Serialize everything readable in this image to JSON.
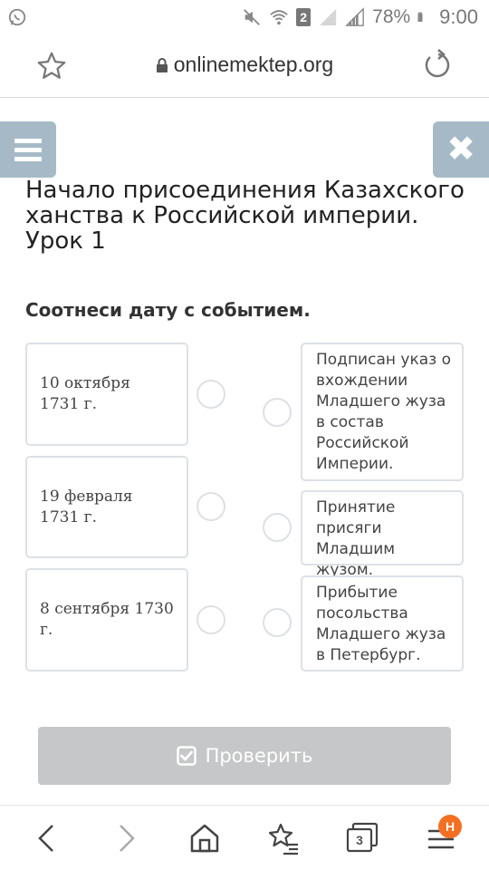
{
  "status_bar": {
    "battery_percent": "78%",
    "time": "9:00",
    "sim_slot": "2",
    "icons": [
      "whatsapp-icon",
      "mute-icon",
      "wifi-icon",
      "sim-2-icon",
      "signal-empty-icon",
      "signal-icon",
      "battery-icon"
    ]
  },
  "browser": {
    "url": "onlinemektep.org",
    "icons": [
      "star-icon",
      "lock-icon",
      "reload-icon"
    ]
  },
  "lesson": {
    "title": "Начало присоединения Казахского ханства к Российской империи. Урок 1",
    "instruction": "Соотнеси дату с событием.",
    "dates": [
      {
        "text": "10 октября 1731 г."
      },
      {
        "text": "19 февраля 1731 г."
      },
      {
        "text": "8 сентября 1730 г."
      }
    ],
    "events": [
      {
        "text": "Подписан указ о вхождении Младшего жуза в состав Российской Империи."
      },
      {
        "text": "Принятие присяги Младшим жузом."
      },
      {
        "text": "Прибытие посольства Младшего жуза в Петербург."
      }
    ],
    "check_button_label": "Проверить"
  },
  "bottom_nav": {
    "tabs_count": "3",
    "menu_badge": "H",
    "icons": [
      "back-arrow-icon",
      "forward-arrow-icon",
      "home-icon",
      "bookmarks-icon",
      "tabs-icon",
      "menu-icon"
    ]
  },
  "colors": {
    "floating_button": "#a5bac6",
    "check_button_disabled": "#c6c7c8",
    "badge": "#f36f21",
    "card_border": "#dde1e5"
  }
}
